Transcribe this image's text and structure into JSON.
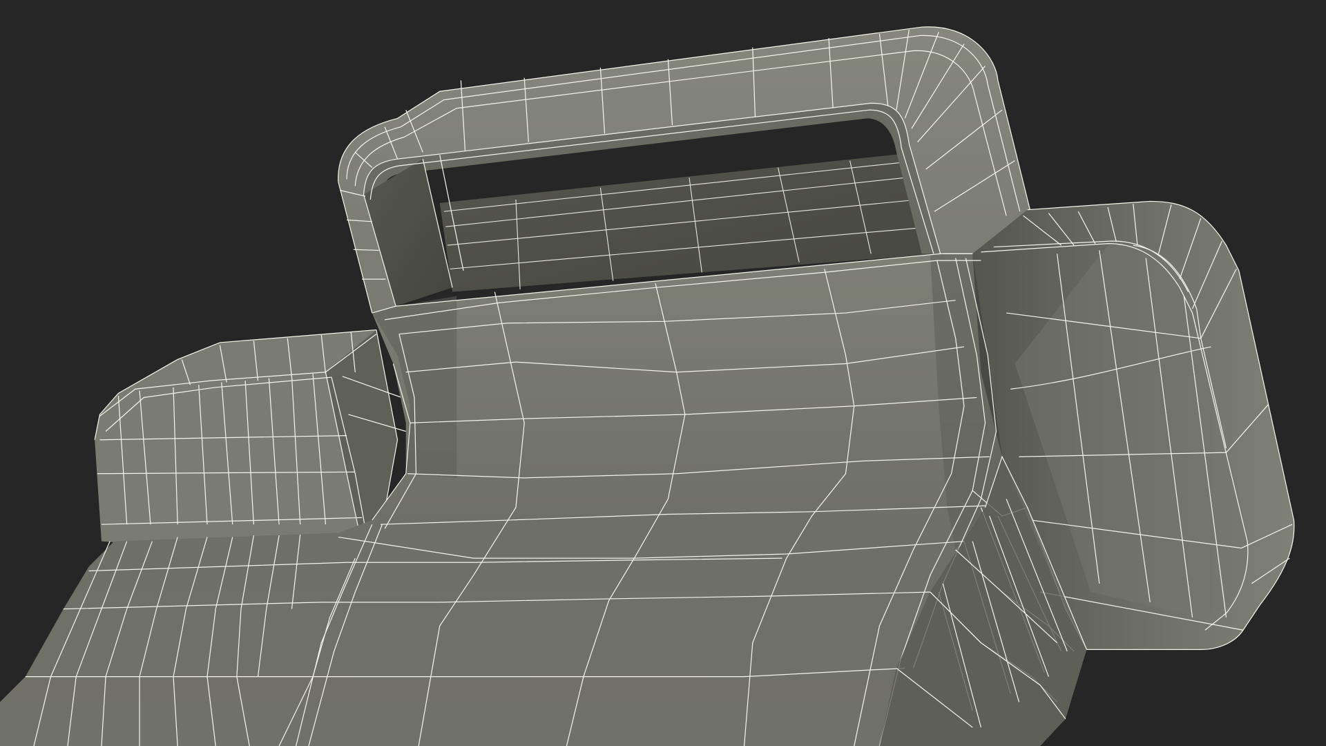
{
  "scene": {
    "subject": "handle",
    "render_style": "wireframe-over-shaded",
    "colors": {
      "background": "#262626",
      "surface_light": "#83847a",
      "surface_mid": "#76776c",
      "surface_dark": "#5b5c54",
      "surface_shadow": "#45463f",
      "wire": "#f2f2ea"
    }
  }
}
